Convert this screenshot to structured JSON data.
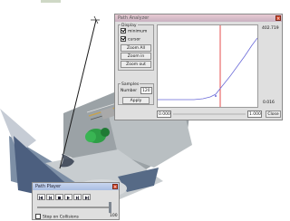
{
  "path_analyzer": {
    "title": "Path Analyzer",
    "close_glyph": "×",
    "display_group": "Display",
    "minimum_label": "minimum",
    "minimum_checked": true,
    "cursor_label": "cursor",
    "cursor_checked": true,
    "zoom_all": "Zoom All",
    "zoom_in": "Zoom in",
    "zoom_out": "Zoom out",
    "samples_group": "Samples",
    "number_label": "Number",
    "number_value": "120",
    "apply": "Apply",
    "y_max": "402.719",
    "y_min": "0.016",
    "x_start": "0.000",
    "x_end": "1.000",
    "close_button": "Close",
    "cursor_color": "#e23a3a",
    "curve_color": "#6a6ad8"
  },
  "path_player": {
    "title": "Path Player",
    "close_glyph": "×",
    "stop_on_collisions": "Stop on Collisions",
    "stop_checked": false,
    "position_value": "100",
    "controls": [
      "rewind-icon",
      "step-back-icon",
      "stop-icon",
      "play-icon",
      "step-forward-icon",
      "fast-forward-icon"
    ]
  }
}
